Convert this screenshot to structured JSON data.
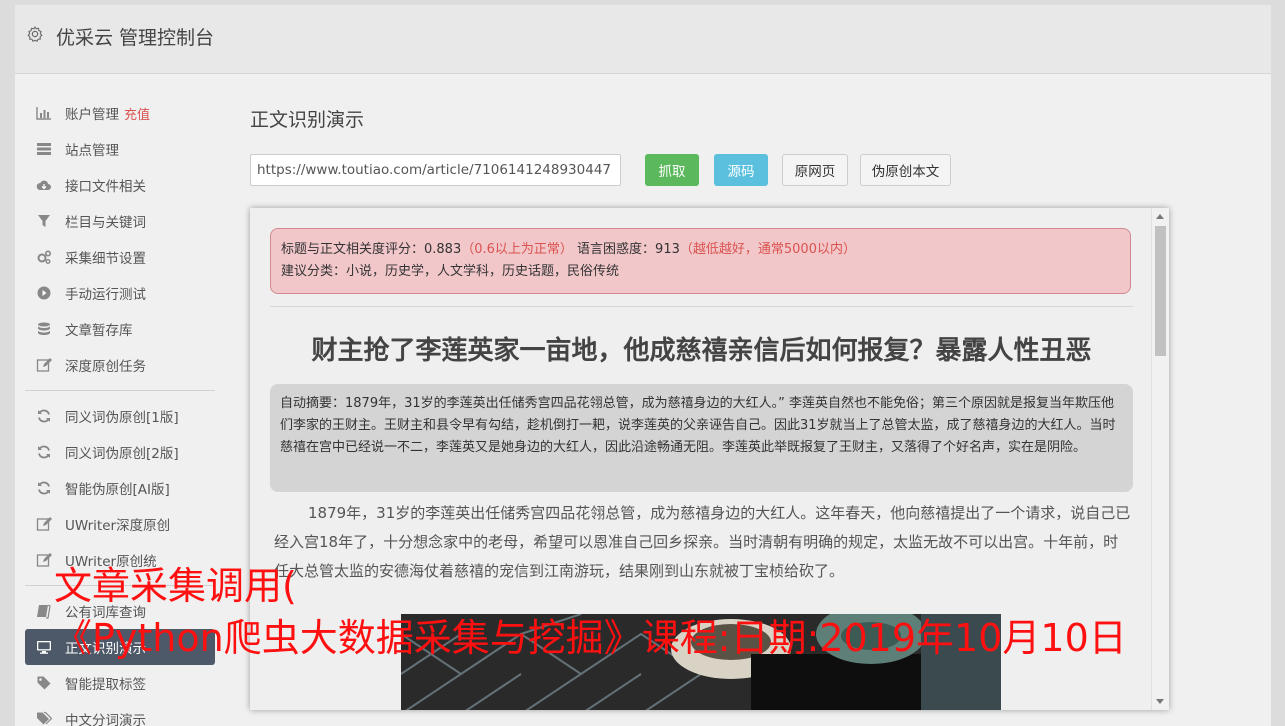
{
  "header": {
    "title": "优采云 管理控制台"
  },
  "sidebar": {
    "groups": [
      [
        {
          "label": "账户管理",
          "badge": "充值",
          "icon": "bar-chart-icon"
        },
        {
          "label": "站点管理",
          "icon": "server-icon"
        },
        {
          "label": "接口文件相关",
          "icon": "cloud-download-icon"
        },
        {
          "label": "栏目与关键词",
          "icon": "filter-icon"
        },
        {
          "label": "采集细节设置",
          "icon": "gears-icon"
        },
        {
          "label": "手动运行测试",
          "icon": "play-circle-icon"
        },
        {
          "label": "文章暂存库",
          "icon": "database-icon"
        },
        {
          "label": "深度原创任务",
          "icon": "edit-icon"
        }
      ],
      [
        {
          "label": "同义词伪原创[1版]",
          "icon": "refresh-icon"
        },
        {
          "label": "同义词伪原创[2版]",
          "icon": "refresh-icon"
        },
        {
          "label": "智能伪原创[AI版]",
          "icon": "refresh-icon"
        },
        {
          "label": "UWriter深度原创",
          "icon": "edit-icon"
        },
        {
          "label": "UWriter原创统",
          "icon": "edit-icon"
        }
      ],
      [
        {
          "label": "公有词库查询",
          "icon": "book-icon"
        },
        {
          "label": "正文识别演示",
          "icon": "desktop-icon",
          "active": true
        },
        {
          "label": "智能提取标签",
          "icon": "tag-icon"
        },
        {
          "label": "中文分词演示",
          "icon": "tags-icon"
        }
      ]
    ]
  },
  "main": {
    "title": "正文识别演示",
    "url_value": "https://www.toutiao.com/article/7106141248930447",
    "buttons": {
      "fetch": "抓取",
      "source": "源码",
      "original": "原网页",
      "rewrite": "伪原创本文"
    }
  },
  "panel": {
    "alert": {
      "line1_a": "标题与正文相关度评分：0.883",
      "line1_b": "（0.6以上为正常）",
      "line1_c": "语言困惑度：913",
      "line1_d": "（越低越好，通常5000以内）",
      "line2": "建议分类：小说，历史学，人文学科，历史话题，民俗传统"
    },
    "article_title": "财主抢了李莲英家一亩地，他成慈禧亲信后如何报复？暴露人性丑恶",
    "summary": "自动摘要：1879年，31岁的李莲英出任储秀宫四品花翎总管，成为慈禧身边的大红人。” 李莲英自然也不能免俗；第三个原因就是报复当年欺压他们李家的王财主。王财主和县令早有勾结，趁机倒打一耙，说李莲英的父亲诬告自己。因此31岁就当上了总管太监，成了慈禧身边的大红人。当时慈禧在宫中已经说一不二，李莲英又是她身边的大红人，因此沿途畅通无阻。李莲英此举既报复了王财主，又落得了个好名声，实在是阴险。",
    "body": "1879年，31岁的李莲英出任储秀宫四品花翎总管，成为慈禧身边的大红人。这年春天，他向慈禧提出了一个请求，说自己已经入宫18年了，十分想念家中的老母，希望可以恩准自己回乡探亲。当时清朝有明确的规定，太监无故不可以出宫。十年前，时任大总管太监的安德海仗着慈禧的宠信到江南游玩，结果刚到山东就被丁宝桢给砍了。"
  },
  "overlay": {
    "line1": "文章采集调用(",
    "line2": "《Python爬虫大数据采集与挖掘》课程:日期:2019年10月10日"
  }
}
